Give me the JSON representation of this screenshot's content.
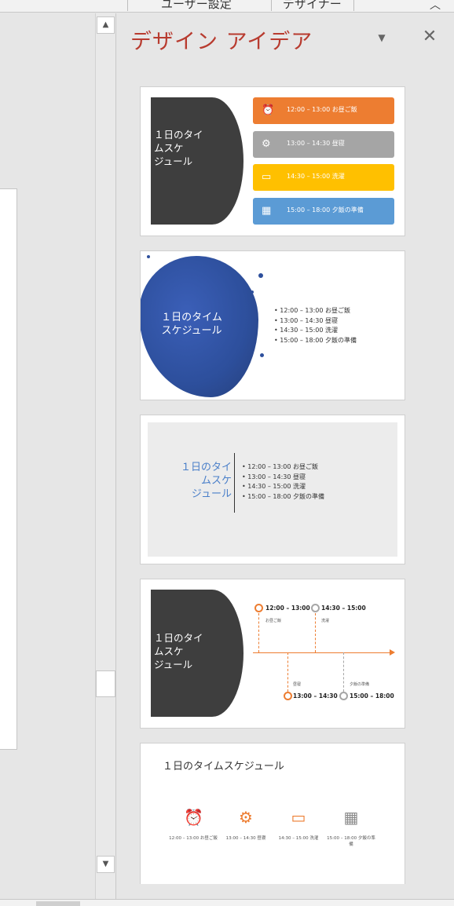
{
  "ribbon": {
    "tabs": [
      "ユーザー設定",
      "デザイナー"
    ],
    "collapse_icon": "chevron-up-icon"
  },
  "scrollbar": {
    "up_icon": "triangle-up-icon",
    "down_icon": "triangle-down-icon"
  },
  "pane": {
    "title": "デザイン アイデア",
    "dropdown_icon": "triangle-down-icon",
    "close_icon": "close-icon"
  },
  "colors": {
    "accent_title": "#b83b2f",
    "orange": "#ed7d31",
    "gray": "#a5a5a5",
    "yellow": "#ffc000",
    "blue": "#5b9bd5",
    "dark": "#3e3e3e",
    "link_blue": "#4a7fc9"
  },
  "ideas": [
    {
      "title_lines": [
        "１日のタイ",
        "ムスケ",
        "ジュール"
      ],
      "items": [
        {
          "text": "12:00 – 13:00 お昼ご飯",
          "icon": "alarm-clock-icon",
          "color": "#ed7d31"
        },
        {
          "text": "13:00 – 14:30 昼寝",
          "icon": "robot-icon",
          "color": "#a5a5a5"
        },
        {
          "text": "14:30 – 15:00 洗濯",
          "icon": "washer-icon",
          "color": "#ffc000"
        },
        {
          "text": "15:00 – 18:00 夕飯の準備",
          "icon": "calendar-icon",
          "color": "#5b9bd5"
        }
      ]
    },
    {
      "title_lines": [
        "１日のタイム",
        "スケジュール"
      ],
      "items": [
        "• 12:00 – 13:00 お昼ご飯",
        "• 13:00 – 14:30 昼寝",
        "• 14:30 – 15:00 洗濯",
        "• 15:00 – 18:00 夕飯の準備"
      ]
    },
    {
      "title_lines": [
        "１日のタイ",
        "ムスケ",
        "ジュール"
      ],
      "items": [
        "• 12:00 – 13:00 お昼ご飯",
        "• 13:00 – 14:30 昼寝",
        "• 14:30 – 15:00 洗濯",
        "• 15:00 – 18:00 夕飯の準備"
      ]
    },
    {
      "title_lines": [
        "１日のタイ",
        "ムスケ",
        "ジュール"
      ],
      "timeline": [
        {
          "time": "12:00 – 13:00",
          "sub": "お昼ご飯"
        },
        {
          "time": "14:30 – 15:00",
          "sub": "洗濯"
        },
        {
          "time": "13:00 – 14:30",
          "sub": "昼寝"
        },
        {
          "time": "15:00 – 18:00",
          "sub": "夕飯の準備"
        }
      ]
    },
    {
      "title": "１日のタイムスケジュール",
      "items": [
        {
          "icon": "alarm-clock-icon",
          "caption": "12:00 – 13:00 お昼ご飯"
        },
        {
          "icon": "robot-icon",
          "caption": "13:00 – 14:30 昼寝"
        },
        {
          "icon": "washer-icon",
          "caption": "14:30 – 15:00 洗濯"
        },
        {
          "icon": "calendar-icon",
          "caption": "15:00 – 18:00 夕飯の準備"
        }
      ]
    }
  ]
}
